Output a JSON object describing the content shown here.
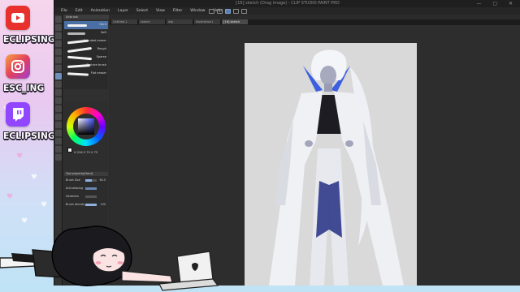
{
  "overlay": {
    "socials": [
      {
        "platform": "youtube",
        "handle": "ECLIPSING ART",
        "color": "#e8302c"
      },
      {
        "platform": "instagram",
        "handle": "ESC_ING",
        "color": "#e0405f"
      },
      {
        "platform": "twitch",
        "handle": "ECLIPSING",
        "color": "#9146ff"
      }
    ]
  },
  "window": {
    "title": "[16] sketch (Drag image) - CLIP STUDIO PAINT PRO"
  },
  "menu": [
    "File",
    "Edit",
    "Animation",
    "Layer",
    "Select",
    "View",
    "Filter",
    "Window",
    "Help"
  ],
  "tabs": [
    "Untitled-1",
    "sketch",
    "wip",
    "illustration1",
    "[16] sketch"
  ],
  "brush_panel": {
    "header": "Airbrush",
    "brushes": [
      {
        "name": "Hard",
        "selected": true
      },
      {
        "name": "Soft"
      },
      {
        "name": "Rounded eraser"
      },
      {
        "name": "Rough"
      },
      {
        "name": "Sparse"
      },
      {
        "name": "Texture brush"
      },
      {
        "name": "Flat eraser"
      }
    ]
  },
  "color": {
    "readout": "H 226  S 79  V 75"
  },
  "tool_property": {
    "title": "Tool property[Hard]",
    "rows": [
      {
        "label": "Brush Size",
        "value": "60.0"
      },
      {
        "label": "Anti-aliasing",
        "value": ""
      },
      {
        "label": "Hardness",
        "value": ""
      },
      {
        "label": "Brush density",
        "value": "100"
      }
    ]
  }
}
